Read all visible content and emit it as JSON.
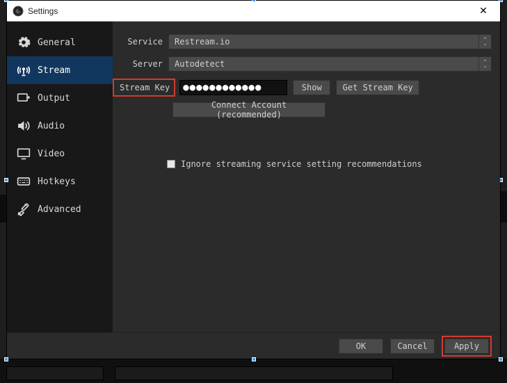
{
  "window": {
    "title": "Settings"
  },
  "sidebar": {
    "items": [
      {
        "label": "General"
      },
      {
        "label": "Stream"
      },
      {
        "label": "Output"
      },
      {
        "label": "Audio"
      },
      {
        "label": "Video"
      },
      {
        "label": "Hotkeys"
      },
      {
        "label": "Advanced"
      }
    ]
  },
  "form": {
    "service_label": "Service",
    "service_value": "Restream.io",
    "server_label": "Server",
    "server_value": "Autodetect",
    "streamkey_label": "Stream Key",
    "streamkey_masked": "●●●●●●●●●●●●",
    "show_btn": "Show",
    "getkey_btn": "Get Stream Key",
    "connect_btn": "Connect Account (recommended)",
    "ignore_label": "Ignore streaming service setting recommendations"
  },
  "footer": {
    "ok": "OK",
    "cancel": "Cancel",
    "apply": "Apply"
  }
}
